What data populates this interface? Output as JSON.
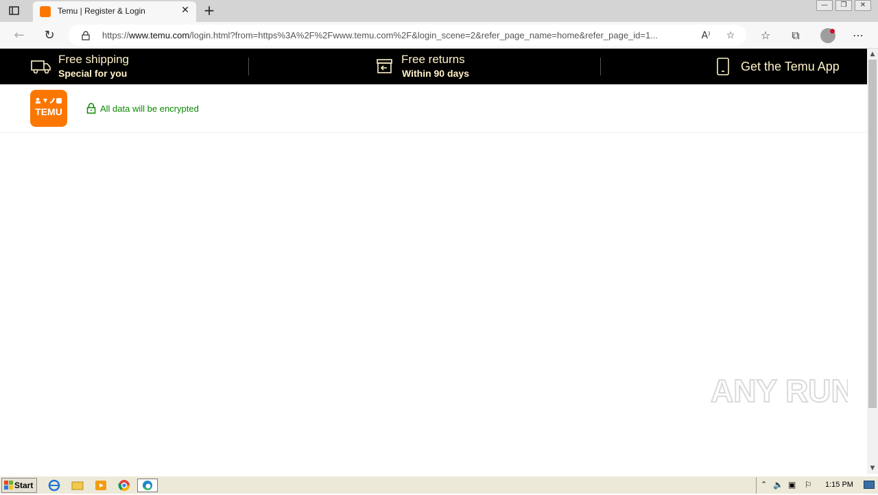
{
  "browser": {
    "tab_title": "Temu | Register & Login",
    "tab_close": "✕",
    "new_tab": "+",
    "url_prefix": "https://",
    "url_host": "www.temu.com",
    "url_path": "/login.html?from=https%3A%2F%2Fwww.temu.com%2F&login_scene=2&refer_page_name=home&refer_page_id=1...",
    "read_aloud": "A⁾",
    "window_controls": [
      "—",
      "❐",
      "✕"
    ]
  },
  "promo": {
    "items": [
      {
        "title": "Free shipping",
        "subtitle": "Special for you"
      },
      {
        "title": "Free returns",
        "subtitle": "Within 90 days"
      },
      {
        "title": "Get the Temu App"
      }
    ]
  },
  "header": {
    "logo_text": "TEMU",
    "secure_text": "All data will be encrypted"
  },
  "watermark": {
    "text": "ANY RUN"
  },
  "taskbar": {
    "start_label": "Start",
    "clock": "1:15 PM"
  },
  "colors": {
    "brand": "#fb7701",
    "promo_bg": "#000000",
    "promo_text": "#fff2c8",
    "secure_green": "#0a8800"
  }
}
